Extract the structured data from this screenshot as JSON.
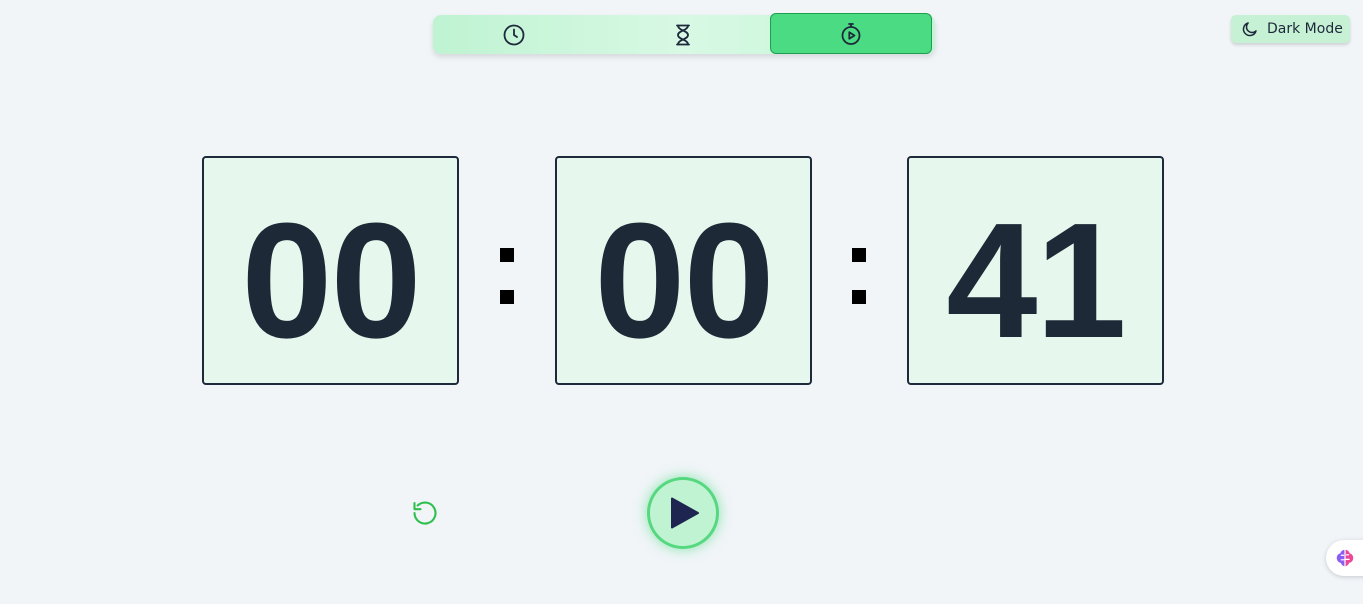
{
  "mode_tabs": [
    {
      "icon": "clock-icon",
      "active": false
    },
    {
      "icon": "hourglass-icon",
      "active": false
    },
    {
      "icon": "stopwatch-icon",
      "active": true
    }
  ],
  "dark_mode": {
    "label": "Dark Mode",
    "icon": "moon-icon"
  },
  "timer": {
    "hours": "00",
    "minutes": "00",
    "seconds": "41"
  },
  "controls": {
    "reset_icon": "reset-icon",
    "play_icon": "play-icon"
  },
  "colors": {
    "background": "#f1f5f8",
    "accent": "#4bdb82",
    "accent_light": "#c0f3d2",
    "digit_box_bg": "#e6f8ee",
    "text_dark": "#1e293b",
    "reset_icon": "#2fbf4f"
  },
  "extension_widget": {
    "icon": "brain-icon"
  }
}
